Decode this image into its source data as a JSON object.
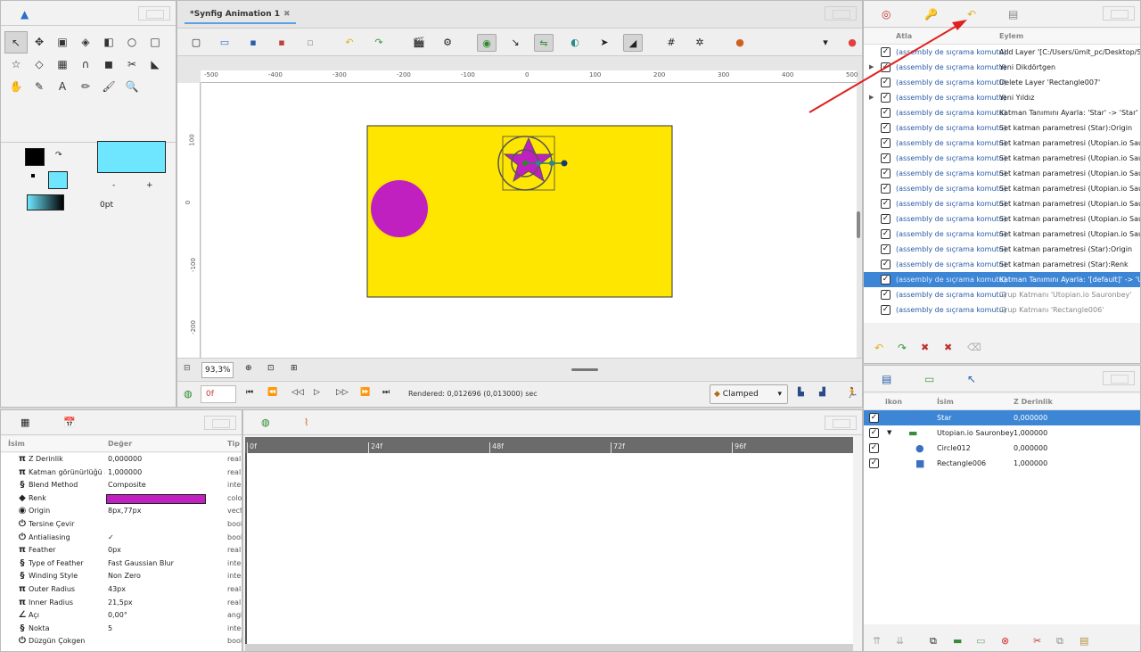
{
  "toolbox": {
    "tools": [
      "↖",
      "✥",
      "▣",
      "◈",
      "◧",
      "○",
      "□",
      "☆",
      "◇",
      "▦",
      "∩",
      "◼",
      "✂",
      "◣",
      "✋",
      "✎",
      "A",
      "✏",
      "🖌",
      "🔍"
    ],
    "outline_width": "0pt",
    "minus": "-",
    "plus": "+",
    "colors": {
      "outline": "#000000",
      "fill": "#6fe6ff"
    }
  },
  "canvas": {
    "tab_title": "*Synfig Animation 1",
    "zoom": "93,3%",
    "frame": "0f",
    "rendered": "Rendered: 0,012696 (0,013000) sec",
    "interpolation": "Clamped",
    "ruler_h": [
      "-500",
      "-400",
      "-300",
      "-200",
      "-100",
      "0",
      "100",
      "200",
      "300",
      "400",
      "500"
    ],
    "ruler_v": [
      "100",
      "0",
      "-100",
      "-200"
    ],
    "colors": {
      "bg": "#ffe600",
      "circle": "#c020c0",
      "star": "#c020c0"
    }
  },
  "history": {
    "col_jump": "Atla",
    "col_action": "Eylem",
    "rows": [
      {
        "jump": "(assembly de sıçrama komutu)",
        "action": "Add Layer '[C:/Users/ümit_pc/Desktop/Sym",
        "dim": false,
        "expand": false
      },
      {
        "jump": "(assembly de sıçrama komutu)",
        "action": "Yeni Dikdörtgen",
        "dim": false,
        "expand": true
      },
      {
        "jump": "(assembly de sıçrama komutu)",
        "action": "Delete Layer 'Rectangle007'",
        "dim": false,
        "expand": false
      },
      {
        "jump": "(assembly de sıçrama komutu)",
        "action": "Yeni Yıldız",
        "dim": false,
        "expand": true
      },
      {
        "jump": "(assembly de sıçrama komutu)",
        "action": "Katman Tanımını Ayarla: 'Star' -> 'Star'",
        "dim": false,
        "expand": false
      },
      {
        "jump": "(assembly de sıçrama komutu)",
        "action": "Set katman parametresi (Star):Origin",
        "dim": false,
        "expand": false
      },
      {
        "jump": "(assembly de sıçrama komutu)",
        "action": "Set katman parametresi (Utopian.io Sauron",
        "dim": false,
        "expand": false
      },
      {
        "jump": "(assembly de sıçrama komutu)",
        "action": "Set katman parametresi (Utopian.io Sauron",
        "dim": false,
        "expand": false
      },
      {
        "jump": "(assembly de sıçrama komutu)",
        "action": "Set katman parametresi (Utopian.io Sauron",
        "dim": false,
        "expand": false
      },
      {
        "jump": "(assembly de sıçrama komutu)",
        "action": "Set katman parametresi (Utopian.io Sauron",
        "dim": false,
        "expand": false
      },
      {
        "jump": "(assembly de sıçrama komutu)",
        "action": "Set katman parametresi (Utopian.io Sauron",
        "dim": false,
        "expand": false
      },
      {
        "jump": "(assembly de sıçrama komutu)",
        "action": "Set katman parametresi (Utopian.io Sauron",
        "dim": false,
        "expand": false
      },
      {
        "jump": "(assembly de sıçrama komutu)",
        "action": "Set katman parametresi (Utopian.io Sauron",
        "dim": false,
        "expand": false
      },
      {
        "jump": "(assembly de sıçrama komutu)",
        "action": "Set katman parametresi (Star):Origin",
        "dim": false,
        "expand": false
      },
      {
        "jump": "(assembly de sıçrama komutu)",
        "action": "Set katman parametresi (Star):Renk",
        "dim": false,
        "expand": false
      },
      {
        "jump": "(assembly de sıçrama komutu)",
        "action": "Katman Tanımını Ayarla: '[default]' -> 'Utop",
        "dim": false,
        "expand": false,
        "selected": true
      },
      {
        "jump": "(assembly de sıçrama komutu)",
        "action": "Grup Katmanı 'Utopian.io Sauronbey'",
        "dim": true,
        "expand": false
      },
      {
        "jump": "(assembly de sıçrama komutu)",
        "action": "Grup Katmanı 'Rectangle006'",
        "dim": true,
        "expand": false
      }
    ]
  },
  "layers": {
    "col_icon": "ikon",
    "col_name": "İsim",
    "col_z": "Z Derinlik",
    "rows": [
      {
        "name": "Star",
        "z": "0,000000",
        "icon": "star-icon",
        "indent": 0,
        "selected": true
      },
      {
        "name": "Utopian.io Sauronbey",
        "z": "1,000000",
        "icon": "folder-icon",
        "indent": 0,
        "selected": false,
        "expand": true
      },
      {
        "name": "Circle012",
        "z": "0,000000",
        "icon": "circle-icon",
        "indent": 1,
        "selected": false
      },
      {
        "name": "Rectangle006",
        "z": "1,000000",
        "icon": "rectangle-icon",
        "indent": 1,
        "selected": false
      }
    ]
  },
  "params": {
    "col_name": "İsim",
    "col_value": "Değer",
    "col_type": "Tip",
    "rows": [
      {
        "icon": "π",
        "name": "Z Derinlik",
        "value": "0,000000",
        "type": "real"
      },
      {
        "icon": "π",
        "name": "Katman görünürlüğü ay",
        "value": "1,000000",
        "type": "real"
      },
      {
        "icon": "§",
        "name": "Blend Method",
        "value": "Composite",
        "type": "integ"
      },
      {
        "icon": "◆",
        "name": "Renk",
        "value": "",
        "type": "color",
        "swatch": "#c020c0"
      },
      {
        "icon": "◉",
        "name": "Origin",
        "value": "8px,77px",
        "type": "vect"
      },
      {
        "icon": "⏻",
        "name": "Tersine Çevir",
        "value": "",
        "type": "bool"
      },
      {
        "icon": "⏻",
        "name": "Antialiasing",
        "value": "✓",
        "type": "bool"
      },
      {
        "icon": "π",
        "name": "Feather",
        "value": "0px",
        "type": "real"
      },
      {
        "icon": "§",
        "name": "Type of Feather",
        "value": "Fast Gaussian Blur",
        "type": "integ"
      },
      {
        "icon": "§",
        "name": "Winding Style",
        "value": "Non Zero",
        "type": "integ"
      },
      {
        "icon": "π",
        "name": "Outer Radius",
        "value": "43px",
        "type": "real"
      },
      {
        "icon": "π",
        "name": "Inner Radius",
        "value": "21,5px",
        "type": "real"
      },
      {
        "icon": "∠",
        "name": "Açı",
        "value": "0,00°",
        "type": "angl"
      },
      {
        "icon": "§",
        "name": "Nokta",
        "value": "5",
        "type": "integ"
      },
      {
        "icon": "⏻",
        "name": "Düzgün Çokgen",
        "value": "",
        "type": "bool"
      }
    ]
  },
  "timetrack": {
    "marks": [
      "0f",
      "24f",
      "48f",
      "72f",
      "96f"
    ]
  }
}
